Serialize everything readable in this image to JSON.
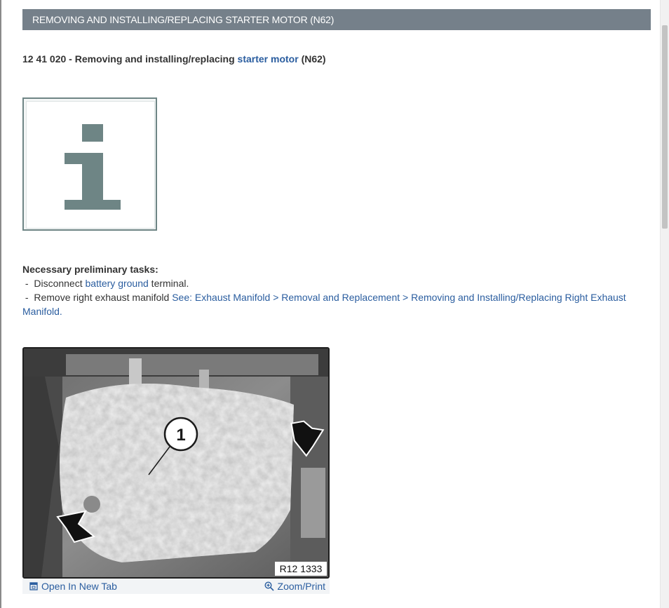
{
  "header": {
    "title": "REMOVING AND INSTALLING/REPLACING STARTER MOTOR (N62)"
  },
  "title_line": {
    "prefix": "12 41 020 - Removing and installing/replacing ",
    "link": "starter motor",
    "suffix": " (N62)"
  },
  "info_icon": {
    "glyph": "i",
    "color": "#6e8585"
  },
  "prelim": {
    "heading": "Necessary preliminary tasks:",
    "task1": {
      "bullet": " -  ",
      "prefix": "Disconnect ",
      "link": "battery ground",
      "suffix": " terminal."
    },
    "task2": {
      "bullet": " -  ",
      "prefix": "Remove right exhaust manifold ",
      "link": "See: Exhaust Manifold > Removal and Replacement > Removing and Installing/Replacing Right Exhaust Manifold."
    }
  },
  "figure": {
    "callout": "1",
    "image_code": "R12 1333",
    "open_new_tab": "Open In New Tab",
    "zoom_print": "Zoom/Print"
  },
  "colors": {
    "header_bg": "#75808a",
    "link": "#2a5d9f"
  }
}
